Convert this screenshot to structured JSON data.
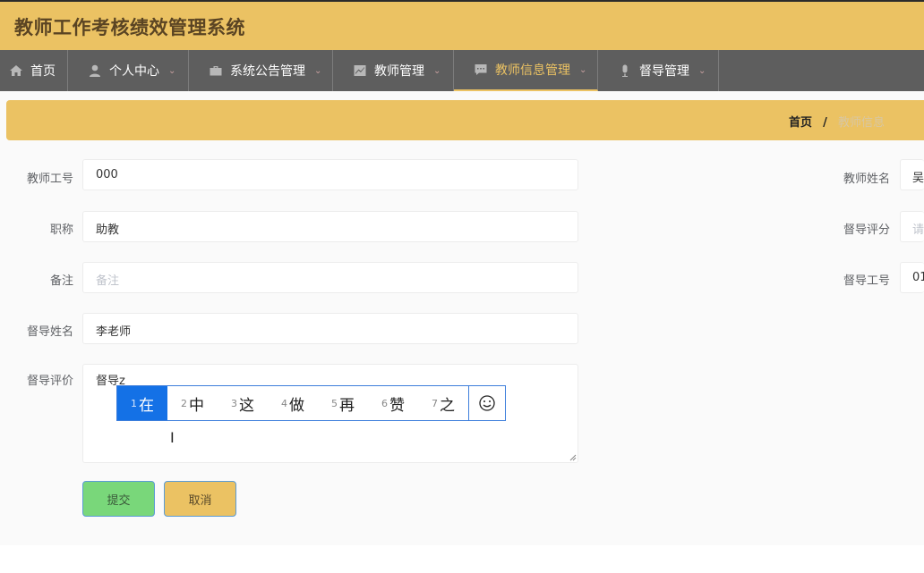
{
  "app": {
    "title": "教师工作考核绩效管理系统"
  },
  "nav": [
    {
      "label": "首页",
      "icon": "home-icon",
      "has_menu": false,
      "active": false
    },
    {
      "label": "个人中心",
      "icon": "user-icon",
      "has_menu": true,
      "active": false
    },
    {
      "label": "系统公告管理",
      "icon": "briefcase-icon",
      "has_menu": true,
      "active": false
    },
    {
      "label": "教师管理",
      "icon": "chart-icon",
      "has_menu": true,
      "active": false
    },
    {
      "label": "教师信息管理",
      "icon": "message-icon",
      "has_menu": true,
      "active": true
    },
    {
      "label": "督导管理",
      "icon": "mic-icon",
      "has_menu": true,
      "active": false
    }
  ],
  "nav_chevron": "⌄",
  "breadcrumb": {
    "home": "首页",
    "separator": "/",
    "current": "教师信息"
  },
  "form": {
    "teacher_id_label": "教师工号",
    "teacher_id_value": "000",
    "title_label": "职称",
    "title_value": "助教",
    "remark_label": "备注",
    "remark_placeholder": "备注",
    "supervisor_name_label": "督导姓名",
    "supervisor_name_value": "李老师",
    "supervisor_comment_label": "督导评价",
    "supervisor_comment_value": "督导z",
    "teacher_name_label": "教师姓名",
    "teacher_name_value": "吴",
    "supervisor_score_label": "督导评分",
    "supervisor_score_placeholder": "请",
    "supervisor_id_label": "督导工号",
    "supervisor_id_value": "01"
  },
  "ime": {
    "candidates": [
      {
        "num": "1",
        "text": "在"
      },
      {
        "num": "2",
        "text": "中"
      },
      {
        "num": "3",
        "text": "这"
      },
      {
        "num": "4",
        "text": "做"
      },
      {
        "num": "5",
        "text": "再"
      },
      {
        "num": "6",
        "text": "赞"
      },
      {
        "num": "7",
        "text": "之"
      }
    ],
    "emoji": "☺"
  },
  "buttons": {
    "submit": "提交",
    "cancel": "取消"
  },
  "cursor_glyph": "I",
  "colors": {
    "accent": "#ebc263",
    "nav_bg": "#5e5e5e",
    "submit": "#79d77a",
    "ime_selected": "#1471e6"
  }
}
